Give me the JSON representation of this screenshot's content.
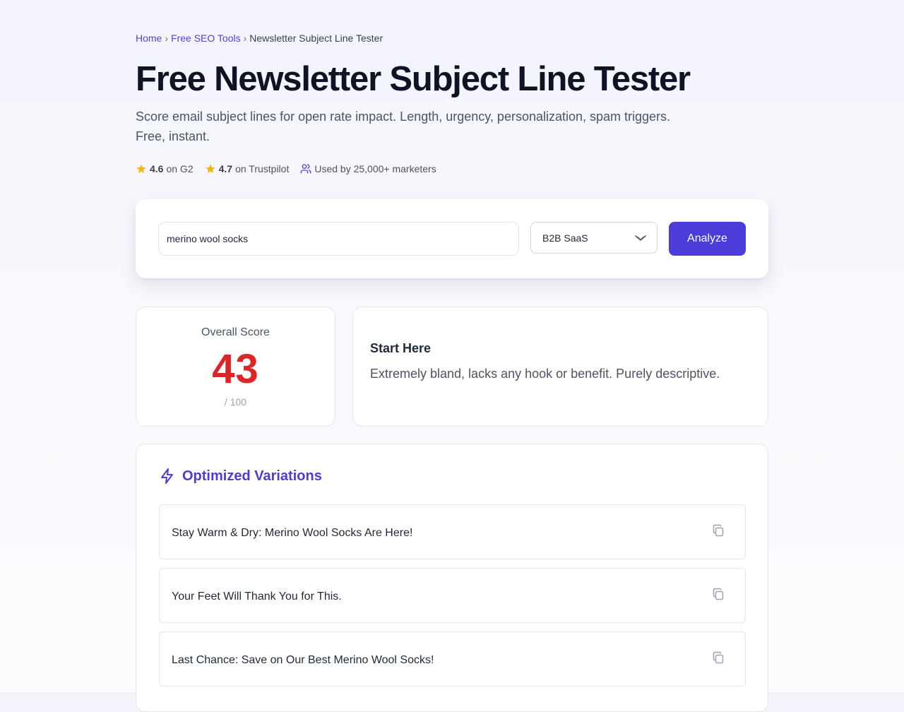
{
  "breadcrumb": {
    "items": [
      {
        "label": "Home"
      },
      {
        "label": "Free SEO Tools"
      },
      {
        "label": "Newsletter Subject Line Tester"
      }
    ],
    "separator": "›"
  },
  "page": {
    "title": "Free Newsletter Subject Line Tester",
    "subtitle": "Score email subject lines for open rate impact. Length, urgency, personalization, spam triggers. Free, instant."
  },
  "ratings": {
    "g2": {
      "score": "4.6",
      "label": "on G2"
    },
    "trustpilot": {
      "score": "4.7",
      "label": "on Trustpilot"
    },
    "users": {
      "label": "Used by 25,000+ marketers"
    }
  },
  "form": {
    "input_value": "merino wool socks",
    "industry_selected": "B2B SaaS",
    "analyze_label": "Analyze"
  },
  "score": {
    "label": "Overall Score",
    "value": "43",
    "max": "/ 100"
  },
  "advice": {
    "title": "Start Here",
    "text": "Extremely bland, lacks any hook or benefit. Purely descriptive."
  },
  "variations": {
    "title": "Optimized Variations",
    "items": [
      {
        "text": "Stay Warm & Dry: Merino Wool Socks Are Here!"
      },
      {
        "text": "Your Feet Will Thank You for This."
      },
      {
        "text": "Last Chance: Save on Our Best Merino Wool Socks!"
      }
    ]
  },
  "colors": {
    "accent": "#4c3ddb",
    "score": "#dc2626",
    "star": "#f5b50a"
  }
}
